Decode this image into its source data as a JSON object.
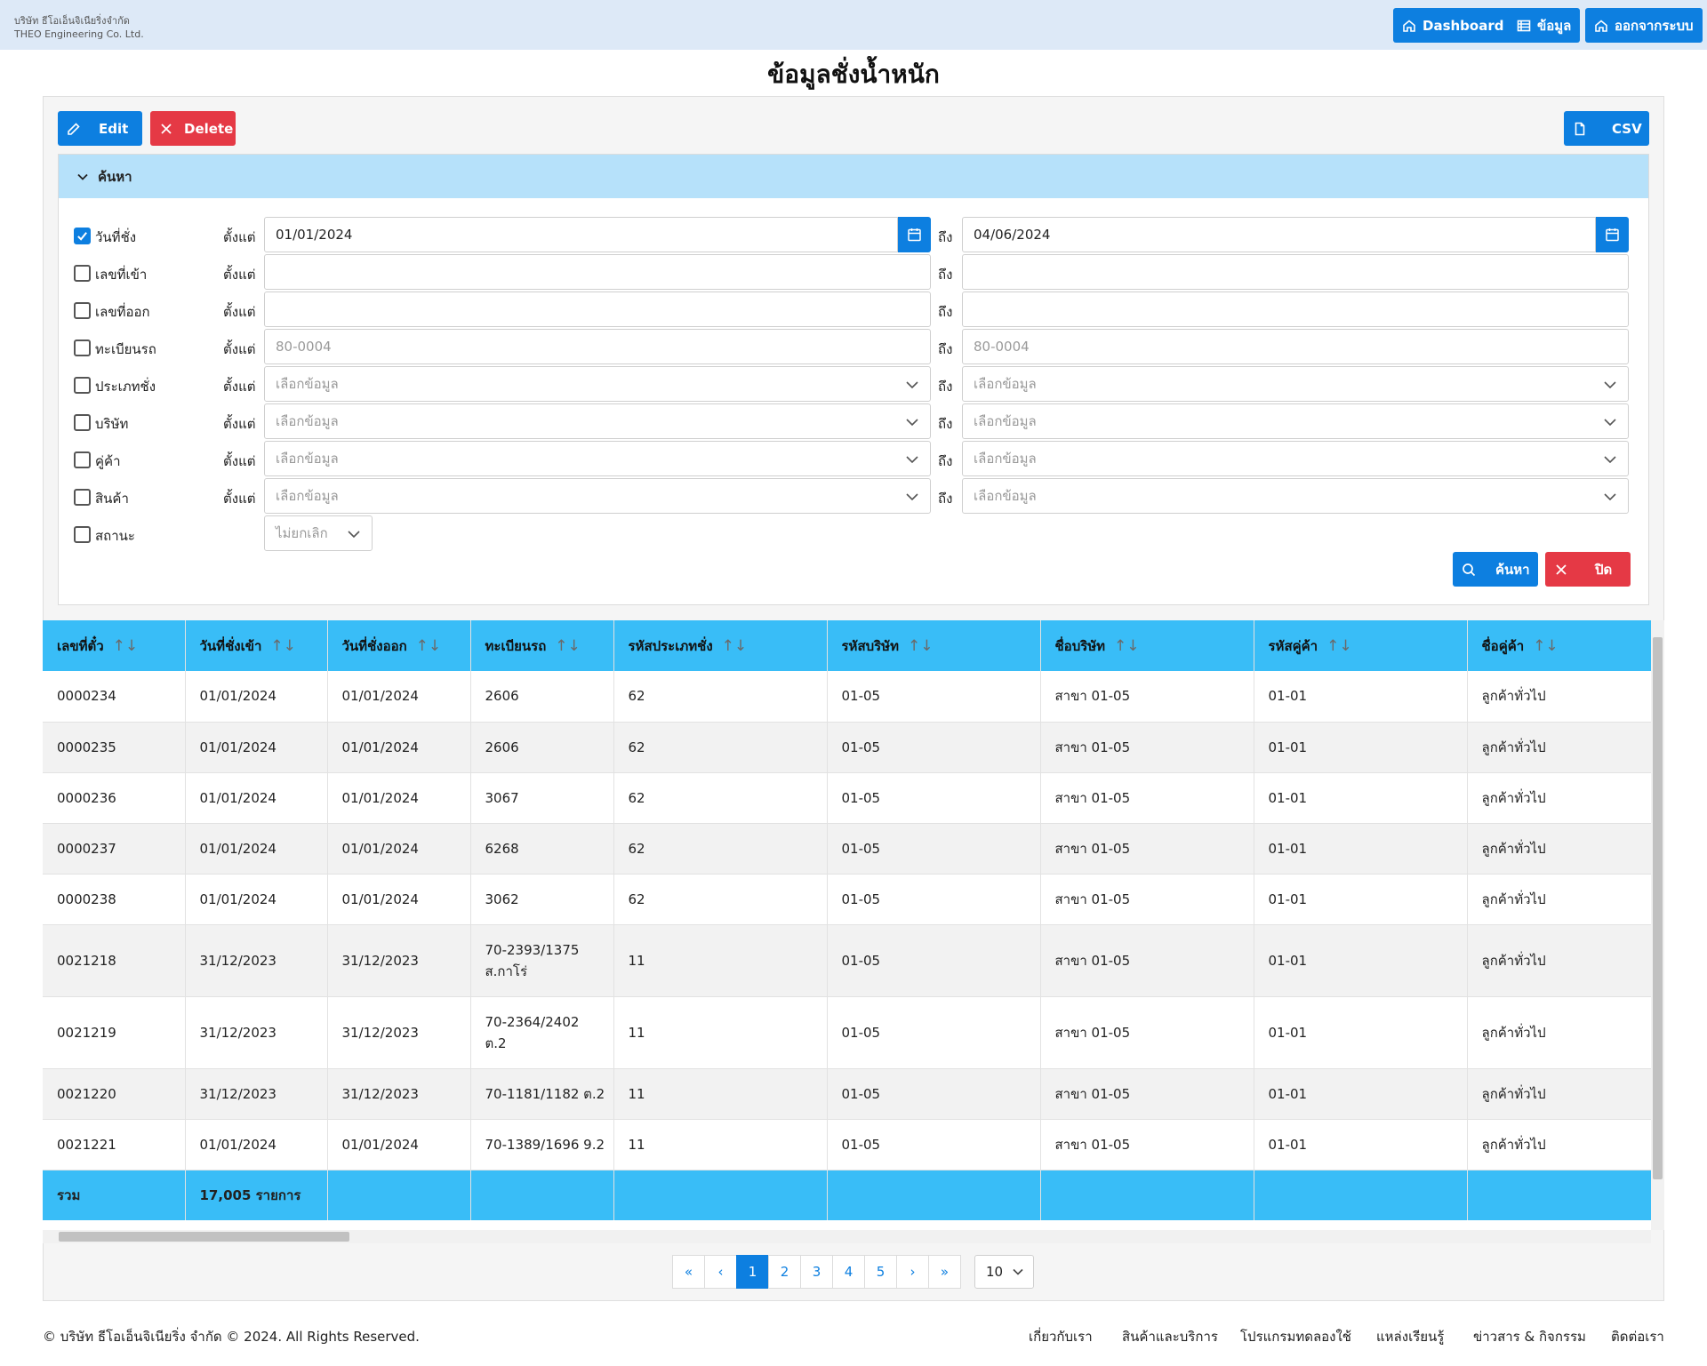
{
  "company": {
    "thai": "บริษัท ธีโอเอ็นจิเนียริ่งจำกัด",
    "english": "THEO Engineering Co. Ltd."
  },
  "nav": {
    "dashboard": "Dashboard",
    "data": "ข้อมูล",
    "logout": "ออกจากระบบ"
  },
  "title": "ข้อมูลชั่งน้ำหนัก",
  "toolbar": {
    "edit": "Edit",
    "delete": "Delete",
    "csv": "CSV"
  },
  "search": {
    "header": "ค้นหา",
    "from_label": "ตั้งแต่",
    "to_label": "ถึง",
    "rows": [
      {
        "label": "วันที่ชั่ง",
        "checked": true,
        "from": "01/01/2024",
        "to": "04/06/2024",
        "type": "date"
      },
      {
        "label": "เลขที่เข้า",
        "checked": false,
        "from": "",
        "to": "",
        "type": "text"
      },
      {
        "label": "เลขที่ออก",
        "checked": false,
        "from": "",
        "to": "",
        "type": "text"
      },
      {
        "label": "ทะเบียนรถ",
        "checked": false,
        "from": "80-0004",
        "to": "80-0004",
        "type": "placeholder"
      },
      {
        "label": "ประเภทชั่ง",
        "checked": false,
        "from": "เลือกข้อมูล",
        "to": "เลือกข้อมูล",
        "type": "select"
      },
      {
        "label": "บริษัท",
        "checked": false,
        "from": "เลือกข้อมูล",
        "to": "เลือกข้อมูล",
        "type": "select"
      },
      {
        "label": "คู่ค้า",
        "checked": false,
        "from": "เลือกข้อมูล",
        "to": "เลือกข้อมูล",
        "type": "select"
      },
      {
        "label": "สินค้า",
        "checked": false,
        "from": "เลือกข้อมูล",
        "to": "เลือกข้อมูล",
        "type": "select"
      }
    ],
    "status_label": "สถานะ",
    "status_value": "ไม่ยกเลิก",
    "search_button": "ค้นหา",
    "close_button": "ปิด"
  },
  "table": {
    "columns": [
      "เลขที่ตั๋ว",
      "วันที่ชั่งเข้า",
      "วันที่ชั่งออก",
      "ทะเบียนรถ",
      "รหัสประเภทชั่ง",
      "รหัสบริษัท",
      "ชื่อบริษัท",
      "รหัสคู่ค้า",
      "ชื่อคู่ค้า"
    ],
    "rows": [
      {
        "ticket": "0000234",
        "in": "01/01/2024",
        "out": "01/01/2024",
        "plate": [
          "2606"
        ],
        "type": "62",
        "company_code": "01-05",
        "company": "สาขา 01-05",
        "partner_code": "01-01",
        "partner": "ลูกค้าทั่วไป"
      },
      {
        "ticket": "0000235",
        "in": "01/01/2024",
        "out": "01/01/2024",
        "plate": [
          "2606"
        ],
        "type": "62",
        "company_code": "01-05",
        "company": "สาขา 01-05",
        "partner_code": "01-01",
        "partner": "ลูกค้าทั่วไป"
      },
      {
        "ticket": "0000236",
        "in": "01/01/2024",
        "out": "01/01/2024",
        "plate": [
          "3067"
        ],
        "type": "62",
        "company_code": "01-05",
        "company": "สาขา 01-05",
        "partner_code": "01-01",
        "partner": "ลูกค้าทั่วไป"
      },
      {
        "ticket": "0000237",
        "in": "01/01/2024",
        "out": "01/01/2024",
        "plate": [
          "6268"
        ],
        "type": "62",
        "company_code": "01-05",
        "company": "สาขา 01-05",
        "partner_code": "01-01",
        "partner": "ลูกค้าทั่วไป"
      },
      {
        "ticket": "0000238",
        "in": "01/01/2024",
        "out": "01/01/2024",
        "plate": [
          "3062"
        ],
        "type": "62",
        "company_code": "01-05",
        "company": "สาขา 01-05",
        "partner_code": "01-01",
        "partner": "ลูกค้าทั่วไป"
      },
      {
        "ticket": "0021218",
        "in": "31/12/2023",
        "out": "31/12/2023",
        "plate": [
          "70-2393/1375",
          "ส.กาโร่"
        ],
        "type": "11",
        "company_code": "01-05",
        "company": "สาขา 01-05",
        "partner_code": "01-01",
        "partner": "ลูกค้าทั่วไป"
      },
      {
        "ticket": "0021219",
        "in": "31/12/2023",
        "out": "31/12/2023",
        "plate": [
          "70-2364/2402",
          "ต.2"
        ],
        "type": "11",
        "company_code": "01-05",
        "company": "สาขา 01-05",
        "partner_code": "01-01",
        "partner": "ลูกค้าทั่วไป"
      },
      {
        "ticket": "0021220",
        "in": "31/12/2023",
        "out": "31/12/2023",
        "plate": [
          "70-1181/1182 ต.2"
        ],
        "type": "11",
        "company_code": "01-05",
        "company": "สาขา 01-05",
        "partner_code": "01-01",
        "partner": "ลูกค้าทั่วไป"
      },
      {
        "ticket": "0021221",
        "in": "01/01/2024",
        "out": "01/01/2024",
        "plate": [
          "70-1389/1696 9.2"
        ],
        "type": "11",
        "company_code": "01-05",
        "company": "สาขา 01-05",
        "partner_code": "01-01",
        "partner": "ลูกค้าทั่วไป"
      }
    ],
    "total_label": "รวม",
    "total_count": "17,005 รายการ"
  },
  "pagination": {
    "pages": [
      "1",
      "2",
      "3",
      "4",
      "5"
    ],
    "current": "1",
    "page_size": "10"
  },
  "footer": {
    "copyright": "© บริษัท ธีโอเอ็นจิเนียริ่ง จำกัด © 2024. All Rights Reserved.",
    "links": [
      "เกี่ยวกับเรา",
      "สินค้าและบริการ",
      "โปรแกรมทดลองใช้",
      "แหล่งเรียนรู้",
      "ข่าวสาร & กิจกรรม",
      "ติดต่อเรา"
    ]
  },
  "colors": {
    "primary": "#0d7fe0",
    "danger": "#e53945",
    "header_blue": "#39bdf7",
    "search_header": "#b6e1fa",
    "topbar": "#dde9f7"
  }
}
